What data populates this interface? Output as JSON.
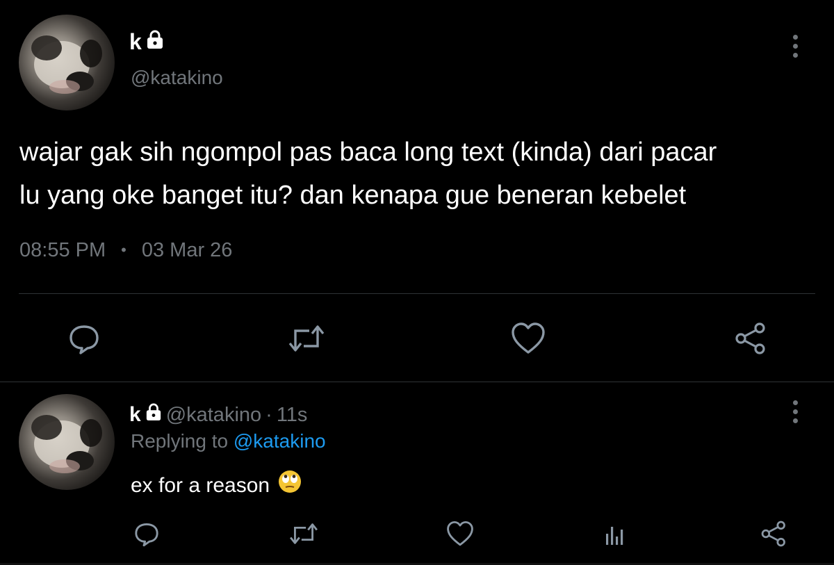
{
  "main_tweet": {
    "display_name": "k",
    "handle": "@katakino",
    "text": "wajar gak sih ngompol pas baca long text (kinda) dari pacar\nlu yang oke banget itu? dan kenapa gue beneran kebelet",
    "time": "08:55 PM",
    "separator": "•",
    "date": "03 Mar 26",
    "icons": {
      "locked": "lock-icon",
      "more": "more-vertical-icon",
      "reply": "reply-icon",
      "retweet": "retweet-icon",
      "like": "heart-icon",
      "share": "share-icon"
    }
  },
  "reply_tweet": {
    "display_name": "k",
    "handle": "@katakino",
    "dot": "·",
    "age": "11s",
    "replying_prefix": "Replying to ",
    "replying_handle": "@katakino",
    "text": "ex for a reason",
    "emoji": "eye-roll-emoji",
    "icons": {
      "reply": "reply-icon",
      "retweet": "retweet-icon",
      "like": "heart-icon",
      "analytics": "analytics-icon",
      "share": "share-icon"
    }
  },
  "colors": {
    "background": "#000000",
    "primary_text": "#ffffff",
    "secondary_text": "#71767b",
    "link": "#1d9bf0",
    "divider": "#2f3336"
  }
}
